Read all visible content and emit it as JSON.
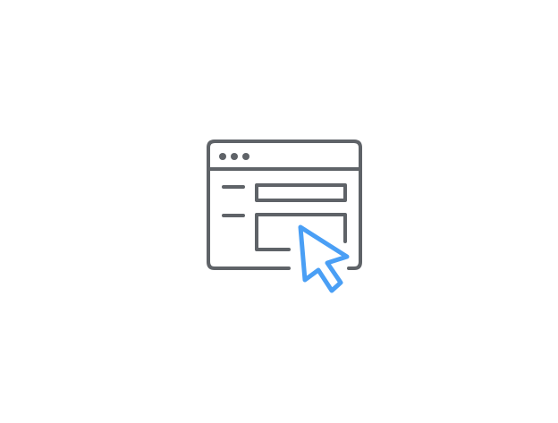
{
  "illustration": {
    "icons": {
      "browser_window": "browser-window-icon",
      "cursor": "mouse-pointer-icon"
    },
    "colors": {
      "background": "#ffffff",
      "window_stroke": "#5f6368",
      "cursor_stroke": "#4a9ff5"
    },
    "window_dots_count": 3,
    "form_rows_count": 2
  }
}
